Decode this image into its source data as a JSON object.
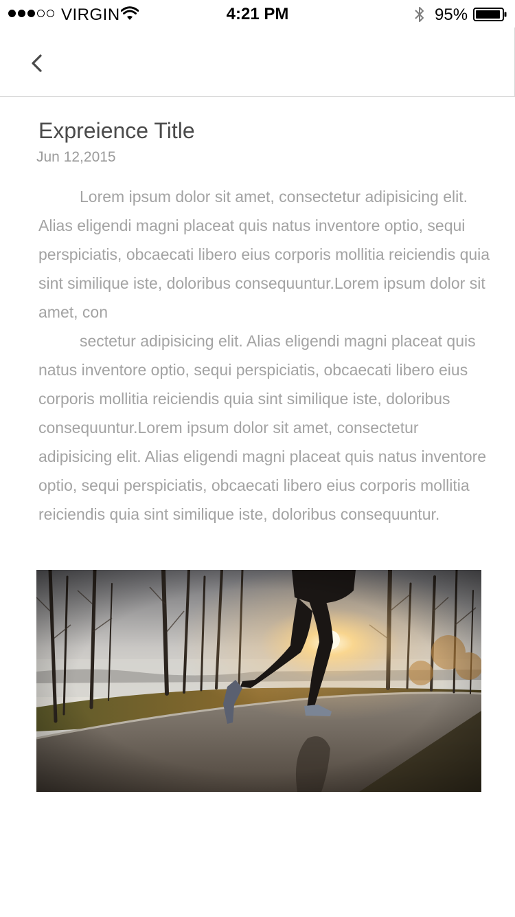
{
  "status_bar": {
    "carrier": "VIRGIN",
    "time": "4:21 PM",
    "battery_percent": "95%",
    "signal_bars_filled": 3,
    "signal_bars_total": 5,
    "battery_level": 0.95,
    "icons": [
      "wifi-icon",
      "bluetooth-icon",
      "battery-icon"
    ]
  },
  "nav": {
    "back_icon": "chevron-left-icon"
  },
  "article": {
    "title": "Expreience Title",
    "date": "Jun 12,2015",
    "paragraphs": [
      "Lorem ipsum dolor sit amet, consectetur adipisicing elit. Alias eligendi magni placeat quis natus inventore optio, sequi perspiciatis, obcaecati libero eius corporis mollitia reiciendis quia sint similique iste, doloribus consequuntur.Lorem ipsum dolor sit amet, con",
      "sectetur adipisicing elit. Alias eligendi magni placeat quis natus inventore optio, sequi perspiciatis, obcaecati libero eius corporis mollitia reiciendis quia sint similique iste, doloribus consequuntur.Lorem ipsum dolor sit amet, consectetur adipisicing elit. Alias eligendi magni placeat quis natus inventore optio, sequi perspiciatis, obcaecati libero eius corporis mollitia reiciendis quia sint similique iste, doloribus consequuntur."
    ],
    "image": "runner-photo"
  },
  "colors": {
    "title": "#4a4a4a",
    "date": "#9b9b9b",
    "body_text": "#a3a3a3",
    "divider": "#d9d9d9"
  }
}
